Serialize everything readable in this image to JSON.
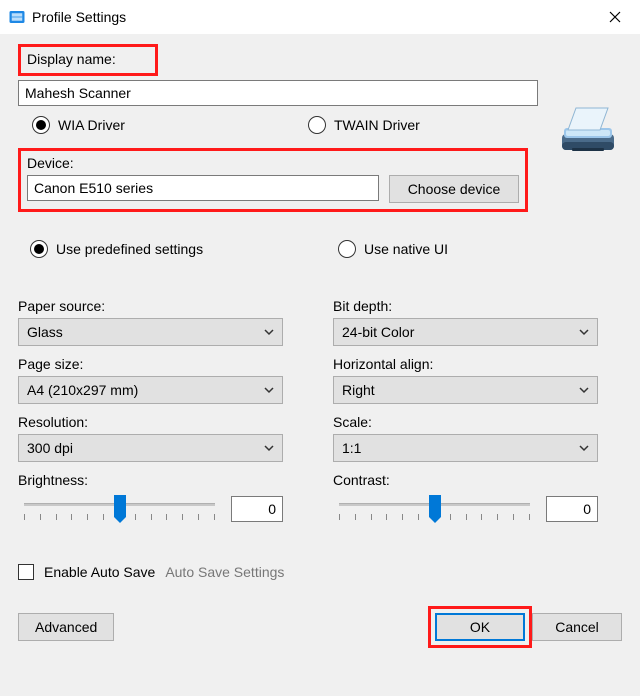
{
  "window": {
    "title": "Profile Settings"
  },
  "displayName": {
    "label": "Display name:",
    "value": "Mahesh Scanner"
  },
  "driver": {
    "wia": "WIA Driver",
    "twain": "TWAIN Driver",
    "selected": "wia"
  },
  "device": {
    "label": "Device:",
    "value": "Canon E510 series",
    "chooseButton": "Choose device"
  },
  "settingsMode": {
    "predefined": "Use predefined settings",
    "native": "Use native UI",
    "selected": "predefined"
  },
  "left": {
    "paperSource": {
      "label": "Paper source:",
      "value": "Glass"
    },
    "pageSize": {
      "label": "Page size:",
      "value": "A4 (210x297 mm)"
    },
    "resolution": {
      "label": "Resolution:",
      "value": "300 dpi"
    },
    "brightness": {
      "label": "Brightness:",
      "value": "0"
    }
  },
  "right": {
    "bitDepth": {
      "label": "Bit depth:",
      "value": "24-bit Color"
    },
    "hAlign": {
      "label": "Horizontal align:",
      "value": "Right"
    },
    "scale": {
      "label": "Scale:",
      "value": "1:1"
    },
    "contrast": {
      "label": "Contrast:",
      "value": "0"
    }
  },
  "autosave": {
    "checkboxLabel": "Enable Auto Save",
    "link": "Auto Save Settings",
    "checked": false
  },
  "footer": {
    "advanced": "Advanced",
    "ok": "OK",
    "cancel": "Cancel"
  }
}
